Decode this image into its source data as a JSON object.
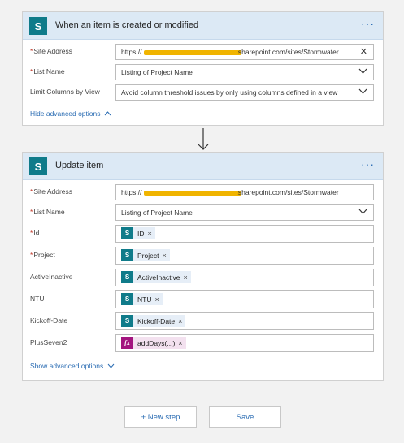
{
  "trigger": {
    "title": "When an item is created or modified",
    "more": "···",
    "site_label": "Site Address",
    "site_prefix": "https://",
    "site_suffix": ".sharepoint.com/sites/Stormwater",
    "site_clear": "✕",
    "list_label": "List Name",
    "list_value": "Listing of Project Name",
    "limit_label": "Limit Columns by View",
    "limit_value": "Avoid column threshold issues by only using columns defined in a view",
    "advanced": "Hide advanced options"
  },
  "action": {
    "title": "Update item",
    "more": "···",
    "site_label": "Site Address",
    "site_prefix": "https://",
    "site_suffix": ".sharepoint.com/sites/Stormwater",
    "list_label": "List Name",
    "list_value": "Listing of Project Name",
    "fields": [
      {
        "label": "Id",
        "required": true,
        "token": "ID"
      },
      {
        "label": "Project",
        "required": true,
        "token": "Project"
      },
      {
        "label": "ActiveInactive",
        "required": false,
        "token": "ActiveInactive"
      },
      {
        "label": "NTU",
        "required": false,
        "token": "NTU"
      },
      {
        "label": "Kickoff-Date",
        "required": false,
        "token": "Kickoff-Date"
      },
      {
        "label": "PlusSeven2",
        "required": false,
        "token": "addDays(...)"
      }
    ],
    "token_remove": "×",
    "advanced": "Show advanced options"
  },
  "buttons": {
    "new_step": "+ New step",
    "save": "Save"
  },
  "icons": {
    "sharepoint": "S",
    "expression": "fx",
    "chevron_down": "⌄",
    "chevron_up": "^"
  }
}
